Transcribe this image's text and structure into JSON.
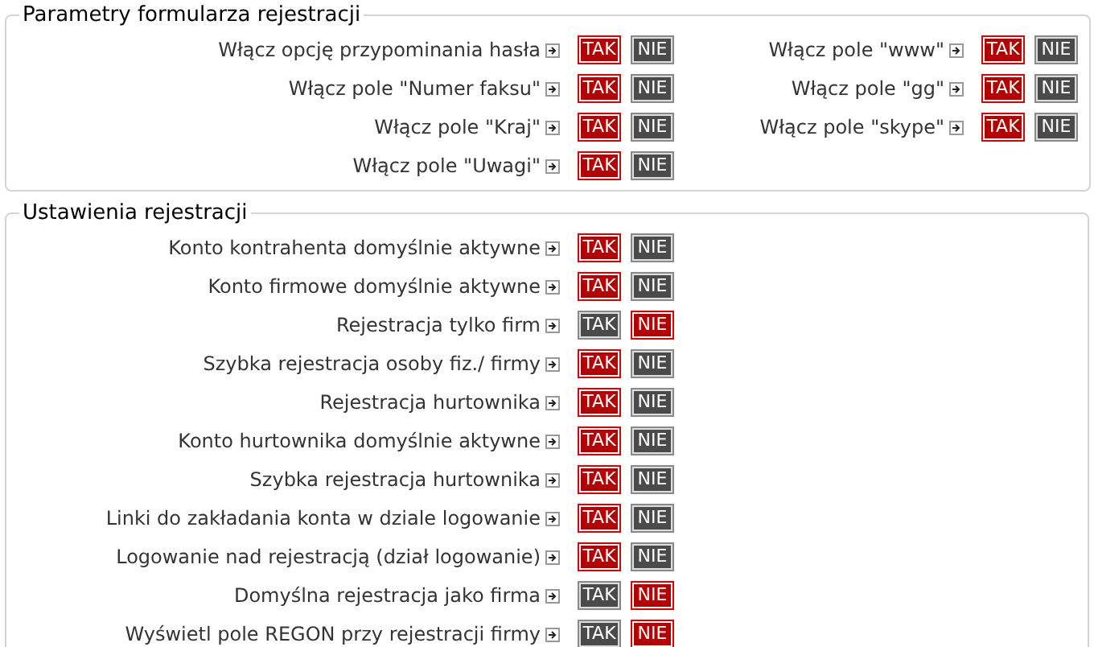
{
  "sections": [
    {
      "title": "Parametry formularza rejestracji",
      "columns": [
        [
          {
            "label": "Włącz opcję przypominania hasła",
            "options": [
              {
                "label": "TAK",
                "selected": true
              },
              {
                "label": "NIE",
                "selected": false
              }
            ]
          },
          {
            "label": "Włącz pole \"Numer faksu\"",
            "options": [
              {
                "label": "TAK",
                "selected": true
              },
              {
                "label": "NIE",
                "selected": false
              }
            ]
          },
          {
            "label": "Włącz pole \"Kraj\"",
            "options": [
              {
                "label": "TAK",
                "selected": true
              },
              {
                "label": "NIE",
                "selected": false
              }
            ]
          },
          {
            "label": "Włącz pole \"Uwagi\"",
            "options": [
              {
                "label": "TAK",
                "selected": true
              },
              {
                "label": "NIE",
                "selected": false
              }
            ]
          }
        ],
        [
          {
            "label": "Włącz pole \"www\"",
            "options": [
              {
                "label": "TAK",
                "selected": true
              },
              {
                "label": "NIE",
                "selected": false
              }
            ]
          },
          {
            "label": "Włącz pole \"gg\"",
            "options": [
              {
                "label": "TAK",
                "selected": true
              },
              {
                "label": "NIE",
                "selected": false
              }
            ]
          },
          {
            "label": "Włącz pole \"skype\"",
            "options": [
              {
                "label": "TAK",
                "selected": true
              },
              {
                "label": "NIE",
                "selected": false
              }
            ]
          }
        ]
      ]
    },
    {
      "title": "Ustawienia rejestracji",
      "columns": [
        [
          {
            "label": "Konto kontrahenta domyślnie aktywne",
            "options": [
              {
                "label": "TAK",
                "selected": true
              },
              {
                "label": "NIE",
                "selected": false
              }
            ]
          },
          {
            "label": "Konto firmowe domyślnie aktywne",
            "options": [
              {
                "label": "TAK",
                "selected": true
              },
              {
                "label": "NIE",
                "selected": false
              }
            ]
          },
          {
            "label": "Rejestracja tylko firm",
            "options": [
              {
                "label": "TAK",
                "selected": false
              },
              {
                "label": "NIE",
                "selected": true
              }
            ]
          },
          {
            "label": "Szybka rejestracja osoby fiz./ firmy",
            "options": [
              {
                "label": "TAK",
                "selected": true
              },
              {
                "label": "NIE",
                "selected": false
              }
            ]
          },
          {
            "label": "Rejestracja hurtownika",
            "options": [
              {
                "label": "TAK",
                "selected": true
              },
              {
                "label": "NIE",
                "selected": false
              }
            ]
          },
          {
            "label": "Konto hurtownika domyślnie aktywne",
            "options": [
              {
                "label": "TAK",
                "selected": true
              },
              {
                "label": "NIE",
                "selected": false
              }
            ]
          },
          {
            "label": "Szybka rejestracja hurtownika",
            "options": [
              {
                "label": "TAK",
                "selected": true
              },
              {
                "label": "NIE",
                "selected": false
              }
            ]
          },
          {
            "label": "Linki do zakładania konta w dziale logowanie",
            "options": [
              {
                "label": "TAK",
                "selected": true
              },
              {
                "label": "NIE",
                "selected": false
              }
            ]
          },
          {
            "label": "Logowanie nad rejestracją (dział logowanie)",
            "options": [
              {
                "label": "TAK",
                "selected": true
              },
              {
                "label": "NIE",
                "selected": false
              }
            ]
          },
          {
            "label": "Domyślna rejestracja jako firma",
            "options": [
              {
                "label": "TAK",
                "selected": false
              },
              {
                "label": "NIE",
                "selected": true
              }
            ]
          },
          {
            "label": "Wyświetl pole REGON przy rejestracji firmy",
            "options": [
              {
                "label": "TAK",
                "selected": false
              },
              {
                "label": "NIE",
                "selected": true
              }
            ]
          }
        ]
      ]
    }
  ]
}
